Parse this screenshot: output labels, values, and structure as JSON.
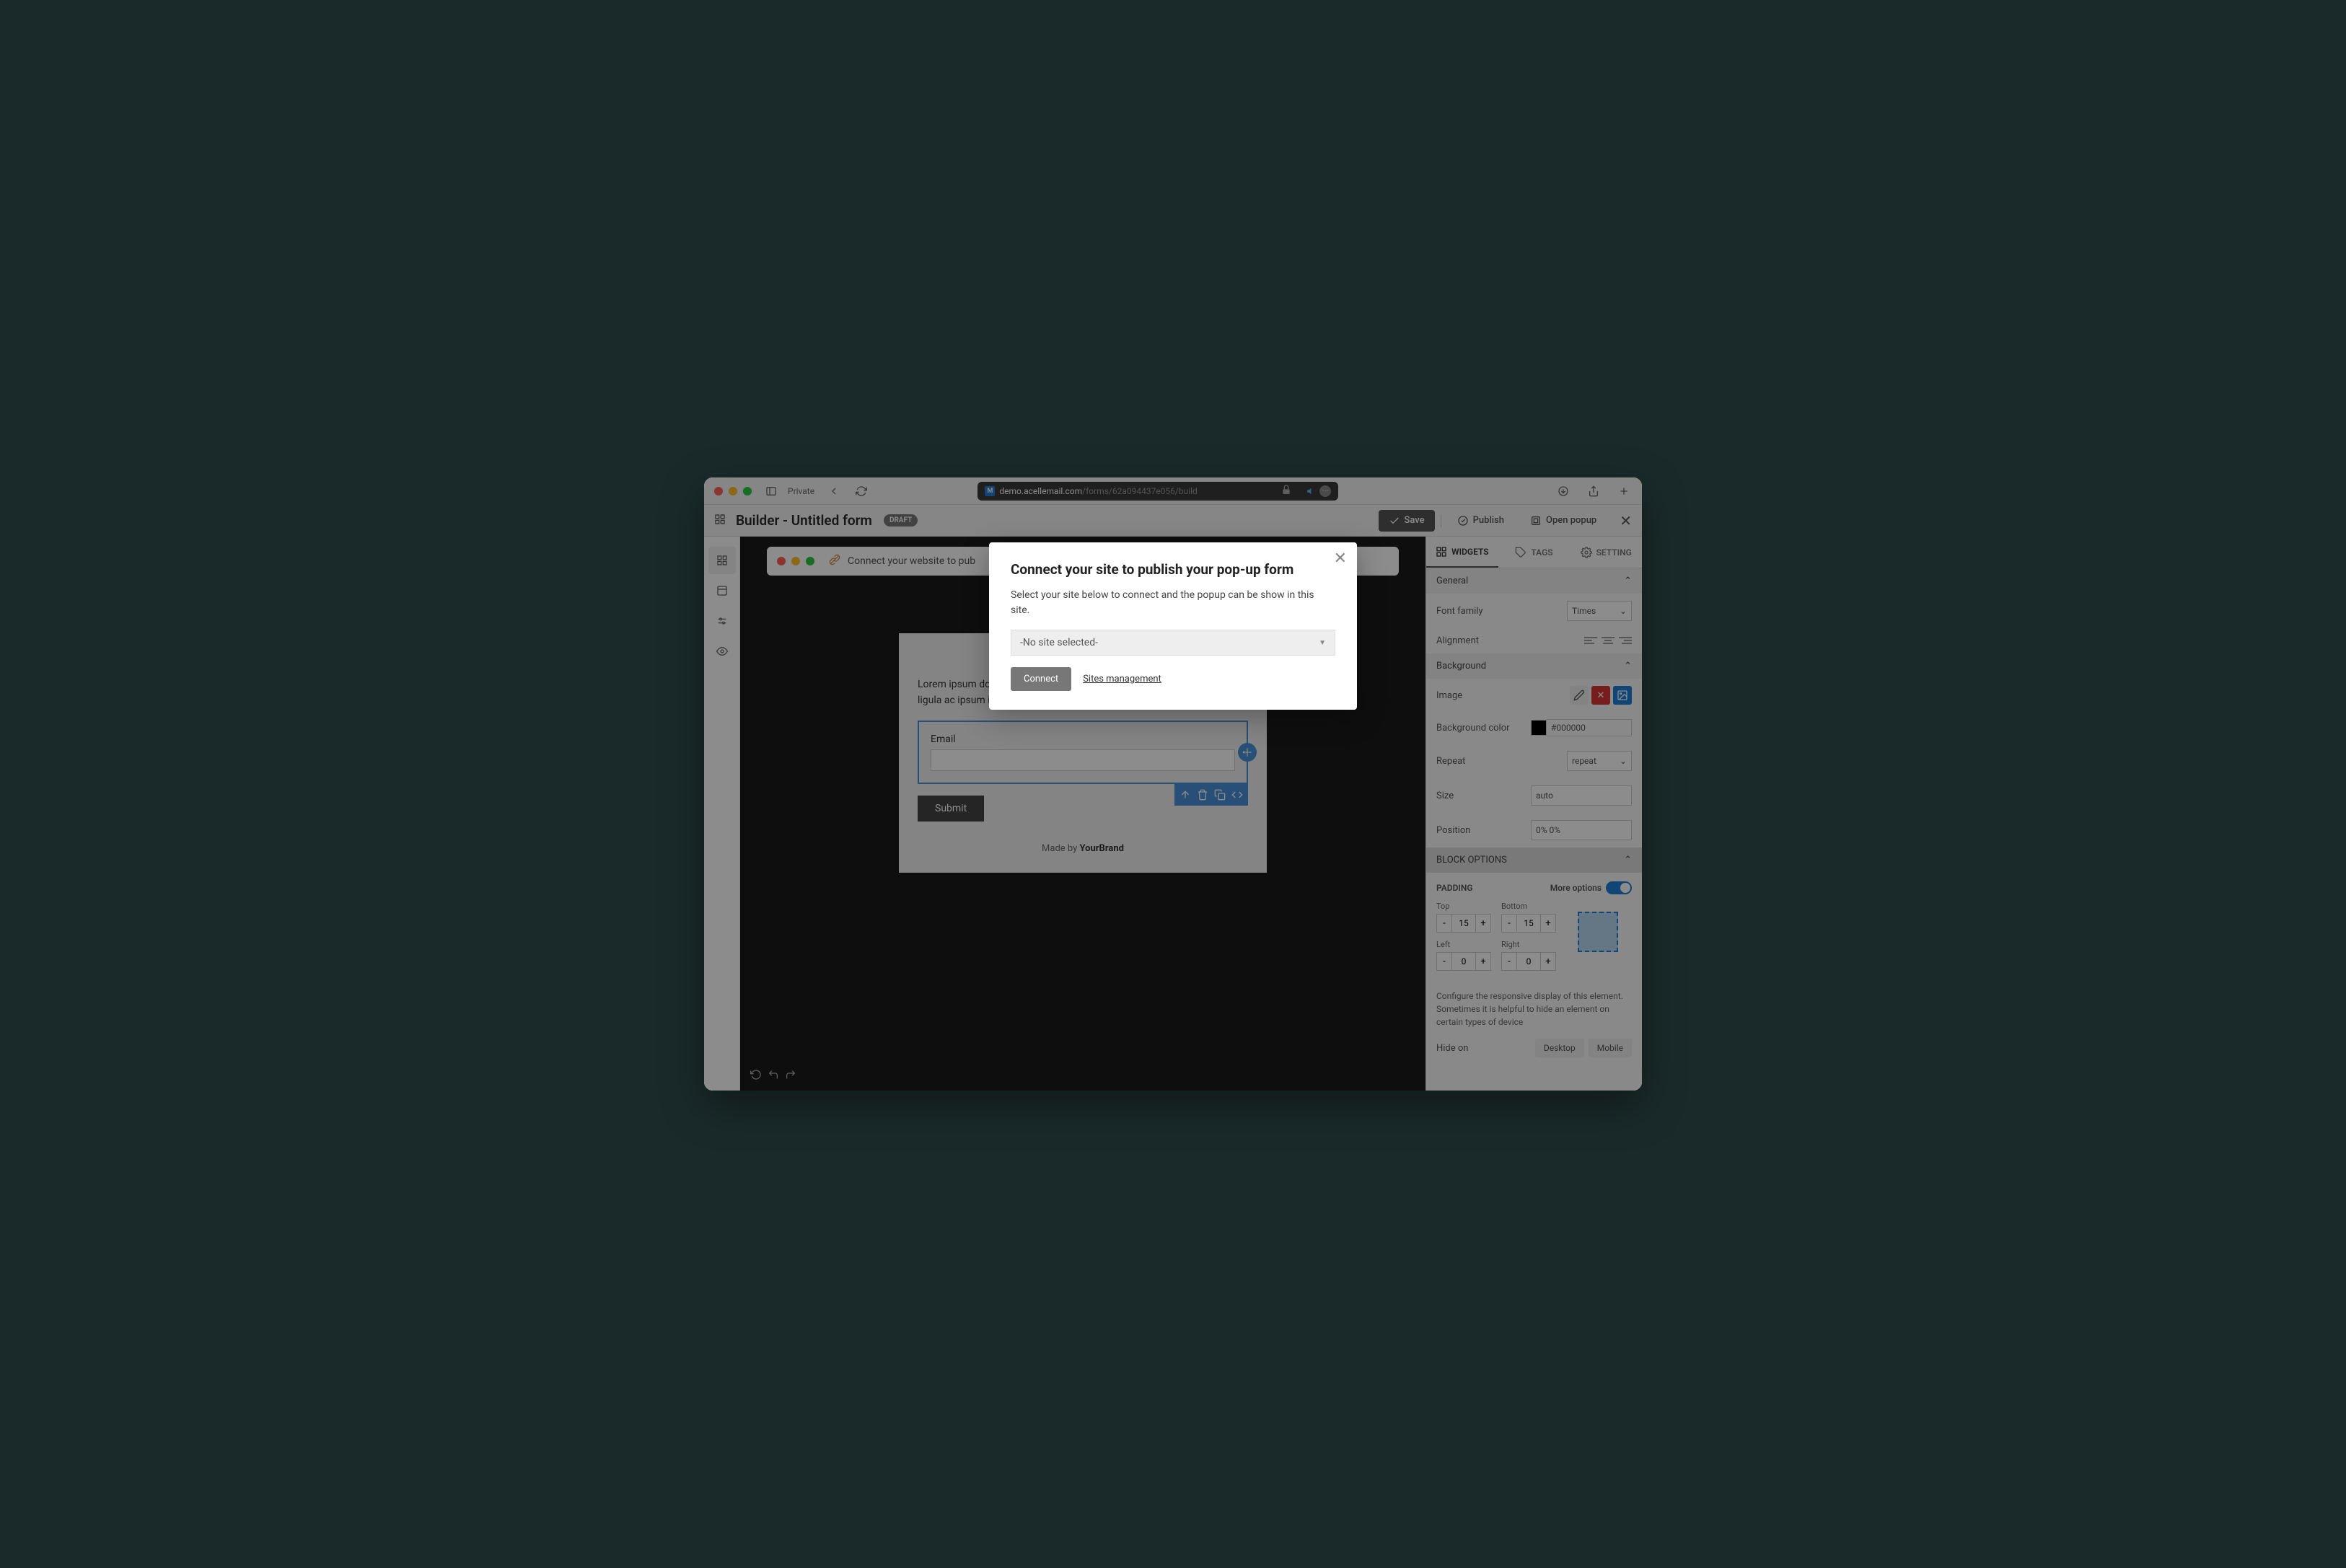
{
  "browser": {
    "private": "Private",
    "url_host": "demo.acellemail.com",
    "url_path": "/forms/62a094437e056/build"
  },
  "toolbar": {
    "title": "Builder - Untitled form",
    "badge": "DRAFT",
    "save": "Save",
    "publish": "Publish",
    "open_popup": "Open popup"
  },
  "connect_banner": "Connect your website to pub",
  "popup": {
    "body_text": "Lorem ipsum dolor sit amet, consectetur adipiscing elit. Morbi tristique ligula ac ipsum interdum.",
    "email_label": "Email",
    "submit": "Submit",
    "footer_made": "Made by ",
    "footer_brand": "YourBrand"
  },
  "panel": {
    "tabs": {
      "widgets": "WIDGETS",
      "tags": "TAGS",
      "setting": "SETTING"
    },
    "general": {
      "title": "General",
      "font_family": "Font family",
      "font_value": "Times",
      "alignment": "Alignment"
    },
    "background": {
      "title": "Background",
      "image": "Image",
      "bg_color": "Background color",
      "bg_color_value": "#000000",
      "repeat": "Repeat",
      "repeat_value": "repeat",
      "size": "Size",
      "size_value": "auto",
      "position": "Position",
      "position_value": "0% 0%"
    },
    "block": {
      "title": "BLOCK OPTIONS",
      "padding": "PADDING",
      "more": "More options",
      "top": "Top",
      "top_v": "15",
      "bottom": "Bottom",
      "bottom_v": "15",
      "left": "Left",
      "left_v": "0",
      "right": "Right",
      "right_v": "0",
      "help": "Configure the responsive display of this element. Sometimes it is helpful to hide an element on certain types of device",
      "hide": "Hide on",
      "desktop": "Desktop",
      "mobile": "Mobile"
    }
  },
  "modal": {
    "title": "Connect your site to publish your pop-up form",
    "desc": "Select your site below to connect and the popup can be show in this site.",
    "select": "-No site selected-",
    "connect": "Connect",
    "manage": "Sites management"
  }
}
